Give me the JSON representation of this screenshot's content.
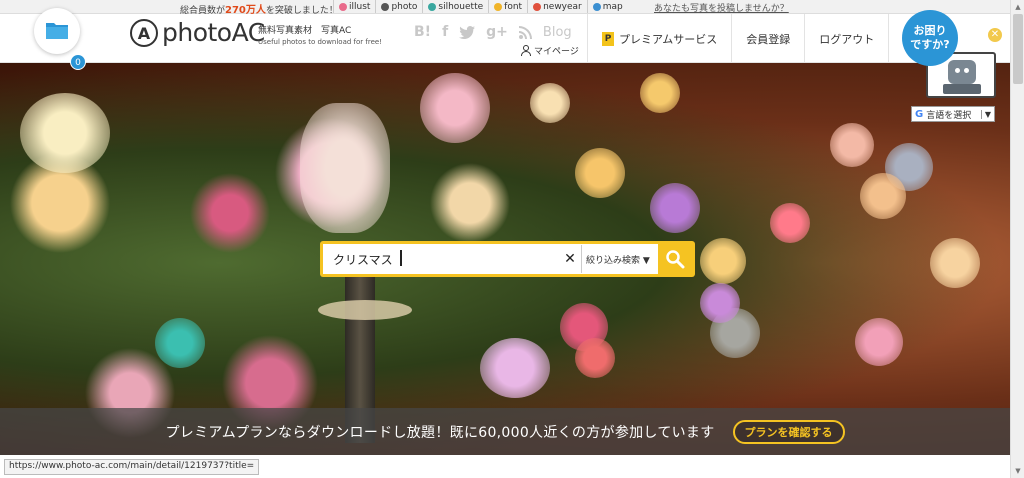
{
  "topstrip": {
    "members_prefix": "総合員数が",
    "members_count": "270万人",
    "members_suffix": "を突破しました！",
    "sites": [
      {
        "icon": "illust-icon",
        "label": "illust",
        "color": "#e96b8b"
      },
      {
        "icon": "photo-icon",
        "label": "photo",
        "color": "#555555"
      },
      {
        "icon": "silhouette-icon",
        "label": "silhouette",
        "color": "#3aa8a0"
      },
      {
        "icon": "font-icon",
        "label": "font",
        "color": "#f0b429"
      },
      {
        "icon": "newyear-icon",
        "label": "newyear",
        "color": "#e0503c"
      },
      {
        "icon": "map-icon",
        "label": "map",
        "color": "#3b8fd1"
      }
    ],
    "post_link": "あなたも写真を投稿しませんか？"
  },
  "header": {
    "folder_count": "0",
    "logo_mark": "A",
    "logo_text": "photoAC",
    "tagline_jp": "無料写真素材　写真AC",
    "tagline_en": "Useful photos to download for free!",
    "blog_label": "Blog",
    "mypage_label": "マイページ",
    "nav": [
      {
        "label": "プレミアムサービス",
        "icon": "premium-p-icon"
      },
      {
        "label": "会員登録"
      },
      {
        "label": "ログアウト"
      }
    ]
  },
  "help": {
    "line1": "お困り",
    "line2": "ですか?"
  },
  "translate": {
    "label": "言語を選択"
  },
  "search": {
    "value": "クリスマス",
    "filter_label": "絞り込み検索 ▼"
  },
  "banner": {
    "text": "プレミアムプランならダウンロードし放題！既に60,000人近くの方が参加しています",
    "button_label": "プランを確認する"
  },
  "statusbar": {
    "url": "https://www.photo-ac.com/main/detail/1219737?title="
  },
  "colors": {
    "accent_yellow": "#f5c322",
    "brand_blue": "#2b95d6"
  }
}
